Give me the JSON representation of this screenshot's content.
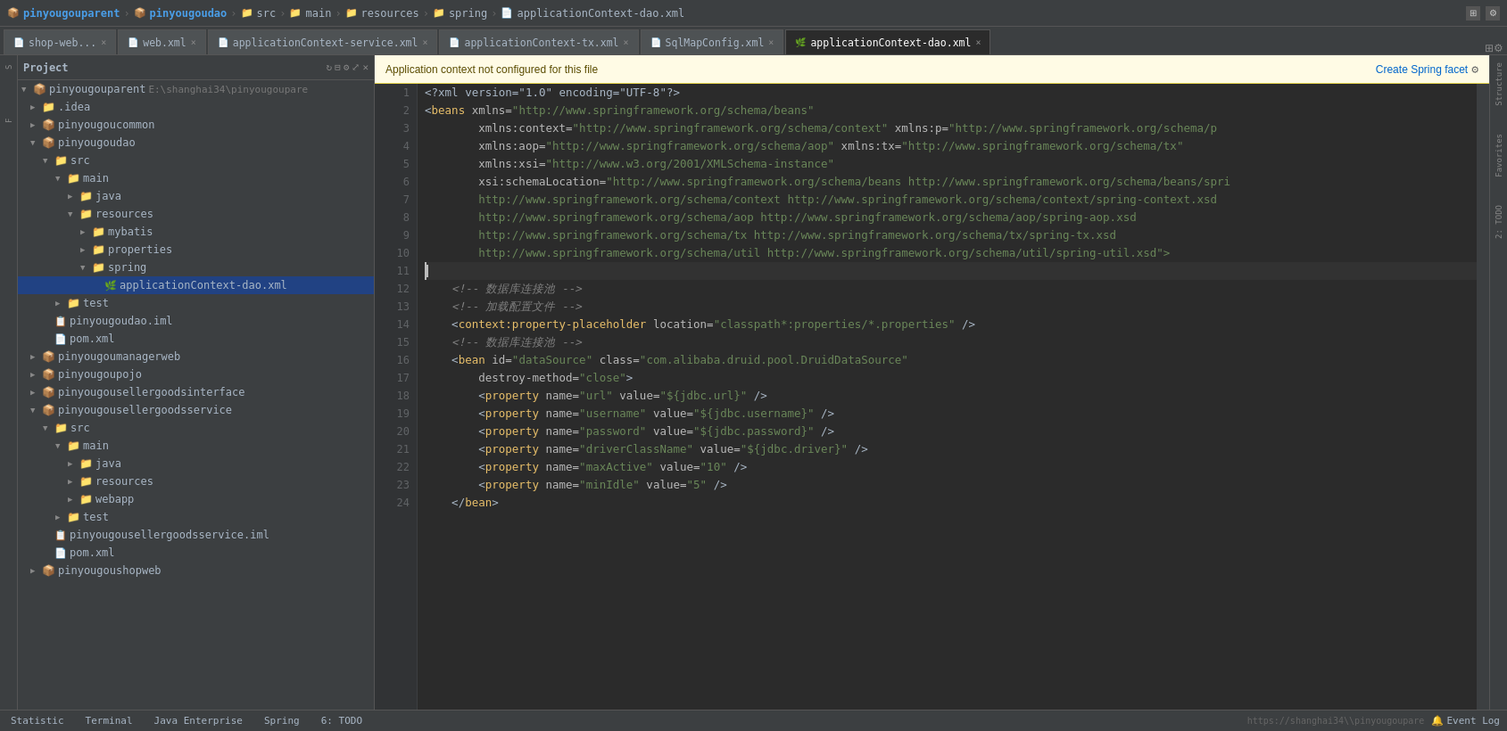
{
  "titlebar": {
    "breadcrumbs": [
      {
        "label": "pinyougouparent",
        "type": "module"
      },
      {
        "label": "pinyougoudao",
        "type": "module"
      },
      {
        "label": "src",
        "type": "folder"
      },
      {
        "label": "main",
        "type": "folder"
      },
      {
        "label": "resources",
        "type": "folder"
      },
      {
        "label": "spring",
        "type": "folder"
      },
      {
        "label": "applicationContext-dao.xml",
        "type": "file"
      }
    ]
  },
  "tabs": [
    {
      "label": "shop-web...",
      "type": "xml",
      "active": false
    },
    {
      "label": "web.xml",
      "type": "xml",
      "active": false
    },
    {
      "label": "applicationContext-service.xml",
      "type": "xml",
      "active": false
    },
    {
      "label": "applicationContext-tx.xml",
      "type": "xml",
      "active": false
    },
    {
      "label": "SqlMapConfig.xml",
      "type": "xml",
      "active": false
    },
    {
      "label": "applicationContext-dao.xml",
      "type": "xml",
      "active": true
    }
  ],
  "warning": {
    "text": "Application context not configured for this file",
    "link": "Create Spring facet",
    "gear": "⚙"
  },
  "project": {
    "title": "Project",
    "tree": [
      {
        "id": "pinyougouparent",
        "level": 0,
        "label": "pinyougouparent",
        "path": "E:\\shanghai34\\pinyougoupare",
        "type": "module",
        "open": true
      },
      {
        "id": "idea",
        "level": 1,
        "label": ".idea",
        "type": "folder",
        "open": false
      },
      {
        "id": "pinyougoucommon",
        "level": 1,
        "label": "pinyougoucommon",
        "type": "module",
        "open": false
      },
      {
        "id": "pinyougoudao",
        "level": 1,
        "label": "pinyougoudao",
        "type": "module",
        "open": true
      },
      {
        "id": "src-dao",
        "level": 2,
        "label": "src",
        "type": "folder",
        "open": true
      },
      {
        "id": "main-dao",
        "level": 3,
        "label": "main",
        "type": "folder",
        "open": true
      },
      {
        "id": "java-dao",
        "level": 4,
        "label": "java",
        "type": "folder",
        "open": false
      },
      {
        "id": "resources-dao",
        "level": 4,
        "label": "resources",
        "type": "folder",
        "open": true
      },
      {
        "id": "mybatis-dao",
        "level": 5,
        "label": "mybatis",
        "type": "folder",
        "open": false
      },
      {
        "id": "properties-dao",
        "level": 5,
        "label": "properties",
        "type": "folder",
        "open": false
      },
      {
        "id": "spring-dao",
        "level": 5,
        "label": "spring",
        "type": "folder",
        "open": true
      },
      {
        "id": "appcontext-dao",
        "level": 6,
        "label": "applicationContext-dao.xml",
        "type": "spring-xml",
        "open": false,
        "selected": true
      },
      {
        "id": "test-dao",
        "level": 3,
        "label": "test",
        "type": "folder",
        "open": false
      },
      {
        "id": "pinyougoudao-iml",
        "level": 2,
        "label": "pinyougoudao.iml",
        "type": "iml",
        "open": false
      },
      {
        "id": "pom-dao",
        "level": 2,
        "label": "pom.xml",
        "type": "xml",
        "open": false
      },
      {
        "id": "pinyougoumanagerweb",
        "level": 1,
        "label": "pinyougoumanagerweb",
        "type": "module",
        "open": false
      },
      {
        "id": "pinyougoupojo",
        "level": 1,
        "label": "pinyougoupojo",
        "type": "module",
        "open": false
      },
      {
        "id": "pinyougousellergoodsinterface",
        "level": 1,
        "label": "pinyougousellergoodsinterface",
        "type": "module",
        "open": false
      },
      {
        "id": "pinyougousellergoodsservice",
        "level": 1,
        "label": "pinyougousellergoodsservice",
        "type": "module",
        "open": true
      },
      {
        "id": "src-sgs",
        "level": 2,
        "label": "src",
        "type": "folder",
        "open": true
      },
      {
        "id": "main-sgs",
        "level": 3,
        "label": "main",
        "type": "folder",
        "open": true
      },
      {
        "id": "java-sgs",
        "level": 4,
        "label": "java",
        "type": "folder",
        "open": false
      },
      {
        "id": "resources-sgs",
        "level": 4,
        "label": "resources",
        "type": "folder",
        "open": false
      },
      {
        "id": "webapp-sgs",
        "level": 4,
        "label": "webapp",
        "type": "folder",
        "open": false
      },
      {
        "id": "test-sgs",
        "level": 3,
        "label": "test",
        "type": "folder",
        "open": false
      },
      {
        "id": "sgs-iml",
        "level": 2,
        "label": "pinyougousellergoodsservice.iml",
        "type": "iml",
        "open": false
      },
      {
        "id": "pom-sgs",
        "level": 2,
        "label": "pom.xml",
        "type": "xml",
        "open": false
      },
      {
        "id": "pinyougoushopweb",
        "level": 1,
        "label": "pinyougoushopweb",
        "type": "module",
        "open": false
      }
    ]
  },
  "editor": {
    "lines": [
      {
        "num": 1,
        "tokens": [
          {
            "t": "<?xml version=\"1.0\" encoding=\"UTF-8\"?>",
            "c": "pi-tag"
          }
        ]
      },
      {
        "num": 2,
        "tokens": [
          {
            "t": "<",
            "c": "kw-white"
          },
          {
            "t": "beans",
            "c": "tag-name"
          },
          {
            "t": " xmlns=",
            "c": "attr-name"
          },
          {
            "t": "\"http://www.springframework.org/schema/beans\"",
            "c": "attr-val"
          }
        ]
      },
      {
        "num": 3,
        "tokens": [
          {
            "t": "        xmlns:context=",
            "c": "attr-name"
          },
          {
            "t": "\"http://www.springframework.org/schema/context\"",
            "c": "attr-val"
          },
          {
            "t": " xmlns:p=",
            "c": "attr-name"
          },
          {
            "t": "\"http://www.springframework.org/schema/p",
            "c": "attr-val"
          }
        ]
      },
      {
        "num": 4,
        "tokens": [
          {
            "t": "        xmlns:aop=",
            "c": "attr-name"
          },
          {
            "t": "\"http://www.springframework.org/schema/aop\"",
            "c": "attr-val"
          },
          {
            "t": " xmlns:tx=",
            "c": "attr-name"
          },
          {
            "t": "\"http://www.springframework.org/schema/tx\"",
            "c": "attr-val"
          }
        ]
      },
      {
        "num": 5,
        "tokens": [
          {
            "t": "        xmlns:xsi=",
            "c": "attr-name"
          },
          {
            "t": "\"http://www.w3.org/2001/XMLSchema-instance\"",
            "c": "attr-val"
          }
        ]
      },
      {
        "num": 6,
        "tokens": [
          {
            "t": "        xsi:schemaLocation=",
            "c": "attr-name"
          },
          {
            "t": "\"http://www.springframework.org/schema/beans http://www.springframework.org/schema/beans/spri",
            "c": "attr-val"
          }
        ]
      },
      {
        "num": 7,
        "tokens": [
          {
            "t": "        http://www.springframework.org/schema/context http://www.springframework.org/schema/context/spring-context.xsd",
            "c": "attr-val"
          }
        ]
      },
      {
        "num": 8,
        "tokens": [
          {
            "t": "        http://www.springframework.org/schema/aop http://www.springframework.org/schema/aop/spring-aop.xsd",
            "c": "attr-val"
          }
        ]
      },
      {
        "num": 9,
        "tokens": [
          {
            "t": "        http://www.springframework.org/schema/tx http://www.springframework.org/schema/tx/spring-tx.xsd",
            "c": "attr-val"
          }
        ]
      },
      {
        "num": 10,
        "tokens": [
          {
            "t": "        http://www.springframework.org/schema/util http://www.springframework.org/schema/util/spring-util.xsd\">",
            "c": "attr-val"
          }
        ]
      },
      {
        "num": 11,
        "tokens": [
          {
            "t": "",
            "c": "kw-white"
          }
        ],
        "cursor": true
      },
      {
        "num": 12,
        "tokens": [
          {
            "t": "    <!-- 数据库连接池 -->",
            "c": "comment"
          }
        ]
      },
      {
        "num": 13,
        "tokens": [
          {
            "t": "    <!-- 加载配置文件 -->",
            "c": "comment"
          }
        ]
      },
      {
        "num": 14,
        "tokens": [
          {
            "t": "    <",
            "c": "kw-white"
          },
          {
            "t": "context:property-placeholder",
            "c": "tag-name"
          },
          {
            "t": " location=",
            "c": "attr-name"
          },
          {
            "t": "\"classpath*:properties/*.properties\"",
            "c": "attr-val"
          },
          {
            "t": " />",
            "c": "kw-white"
          }
        ]
      },
      {
        "num": 15,
        "tokens": [
          {
            "t": "    <!-- 数据库连接池 -->",
            "c": "comment"
          }
        ]
      },
      {
        "num": 16,
        "tokens": [
          {
            "t": "    <",
            "c": "kw-white"
          },
          {
            "t": "bean",
            "c": "tag-name"
          },
          {
            "t": " id=",
            "c": "attr-name"
          },
          {
            "t": "\"dataSource\"",
            "c": "attr-val"
          },
          {
            "t": " class=",
            "c": "attr-name"
          },
          {
            "t": "\"com.alibaba.druid.pool.DruidDataSource\"",
            "c": "attr-val"
          }
        ]
      },
      {
        "num": 17,
        "tokens": [
          {
            "t": "        destroy-method=",
            "c": "attr-name"
          },
          {
            "t": "\"close\"",
            "c": "attr-val"
          },
          {
            "t": ">",
            "c": "kw-white"
          }
        ]
      },
      {
        "num": 18,
        "tokens": [
          {
            "t": "        <",
            "c": "kw-white"
          },
          {
            "t": "property",
            "c": "tag-name"
          },
          {
            "t": " name=",
            "c": "attr-name"
          },
          {
            "t": "\"url\"",
            "c": "attr-val"
          },
          {
            "t": " value=",
            "c": "attr-name"
          },
          {
            "t": "\"${jdbc.url}\"",
            "c": "attr-val"
          },
          {
            "t": " />",
            "c": "kw-white"
          }
        ]
      },
      {
        "num": 19,
        "tokens": [
          {
            "t": "        <",
            "c": "kw-white"
          },
          {
            "t": "property",
            "c": "tag-name"
          },
          {
            "t": " name=",
            "c": "attr-name"
          },
          {
            "t": "\"username\"",
            "c": "attr-val"
          },
          {
            "t": " value=",
            "c": "attr-name"
          },
          {
            "t": "\"${jdbc.username}\"",
            "c": "attr-val"
          },
          {
            "t": " />",
            "c": "kw-white"
          }
        ]
      },
      {
        "num": 20,
        "tokens": [
          {
            "t": "        <",
            "c": "kw-white"
          },
          {
            "t": "property",
            "c": "tag-name"
          },
          {
            "t": " name=",
            "c": "attr-name"
          },
          {
            "t": "\"password\"",
            "c": "attr-val"
          },
          {
            "t": " value=",
            "c": "attr-name"
          },
          {
            "t": "\"${jdbc.password}\"",
            "c": "attr-val"
          },
          {
            "t": " />",
            "c": "kw-white"
          }
        ]
      },
      {
        "num": 21,
        "tokens": [
          {
            "t": "        <",
            "c": "kw-white"
          },
          {
            "t": "property",
            "c": "tag-name"
          },
          {
            "t": " name=",
            "c": "attr-name"
          },
          {
            "t": "\"driverClassName\"",
            "c": "attr-val"
          },
          {
            "t": " value=",
            "c": "attr-name"
          },
          {
            "t": "\"${jdbc.driver}\"",
            "c": "attr-val"
          },
          {
            "t": " />",
            "c": "kw-white"
          }
        ]
      },
      {
        "num": 22,
        "tokens": [
          {
            "t": "        <",
            "c": "kw-white"
          },
          {
            "t": "property",
            "c": "tag-name"
          },
          {
            "t": " name=",
            "c": "attr-name"
          },
          {
            "t": "\"maxActive\"",
            "c": "attr-val"
          },
          {
            "t": " value=",
            "c": "attr-name"
          },
          {
            "t": "\"10\"",
            "c": "attr-val"
          },
          {
            "t": " />",
            "c": "kw-white"
          }
        ]
      },
      {
        "num": 23,
        "tokens": [
          {
            "t": "        <",
            "c": "kw-white"
          },
          {
            "t": "property",
            "c": "tag-name"
          },
          {
            "t": " name=",
            "c": "attr-name"
          },
          {
            "t": "\"minIdle\"",
            "c": "attr-val"
          },
          {
            "t": " value=",
            "c": "attr-name"
          },
          {
            "t": "\"5\"",
            "c": "attr-val"
          },
          {
            "t": " />",
            "c": "kw-white"
          }
        ]
      },
      {
        "num": 24,
        "tokens": [
          {
            "t": "    </",
            "c": "kw-white"
          },
          {
            "t": "bean",
            "c": "tag-name"
          },
          {
            "t": ">",
            "c": "kw-white"
          }
        ]
      }
    ]
  },
  "bottom_tabs": [
    {
      "label": "Statistic",
      "active": false
    },
    {
      "label": "Terminal",
      "active": false
    },
    {
      "label": "Java Enterprise",
      "active": false
    },
    {
      "label": "Spring",
      "active": false
    },
    {
      "label": "6: TODO",
      "active": false
    }
  ],
  "bottom_right": {
    "event_log": "Event Log"
  }
}
